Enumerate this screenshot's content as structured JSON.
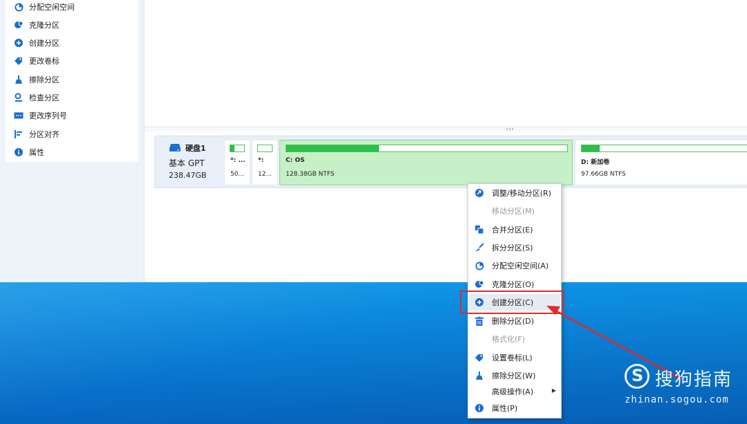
{
  "sidebar": {
    "items": [
      {
        "label": "分配空闲空间",
        "icon": "pie-chart-icon"
      },
      {
        "label": "克隆分区",
        "icon": "clone-icon"
      },
      {
        "label": "创建分区",
        "icon": "create-partition-icon"
      },
      {
        "label": "更改卷标",
        "icon": "tag-icon"
      },
      {
        "label": "擦除分区",
        "icon": "wipe-icon"
      },
      {
        "label": "检查分区",
        "icon": "check-icon"
      },
      {
        "label": "更改序列号",
        "icon": "serial-icon"
      },
      {
        "label": "分区对齐",
        "icon": "align-icon"
      },
      {
        "label": "属性",
        "icon": "info-icon"
      }
    ]
  },
  "disk": {
    "name": "硬盘1",
    "type": "基本 GPT",
    "size": "238.47GB",
    "partitions": [
      {
        "name": "*: ...",
        "size": "50...",
        "used_fraction": 0.3
      },
      {
        "name": "*:",
        "size": "12...",
        "used_fraction": 0.0
      },
      {
        "name": "C: OS",
        "size": "128.38GB NTFS",
        "used_fraction": 0.33
      },
      {
        "name": "D: 新加卷",
        "size": "97.66GB NTFS",
        "used_fraction": 0.1
      }
    ]
  },
  "context_menu": {
    "items": [
      {
        "label": "调整/移动分区(R)",
        "icon": "resize-icon",
        "enabled": true
      },
      {
        "label": "移动分区(M)",
        "icon": "",
        "enabled": false
      },
      {
        "label": "合并分区(E)",
        "icon": "merge-icon",
        "enabled": true
      },
      {
        "label": "拆分分区(S)",
        "icon": "split-icon",
        "enabled": true
      },
      {
        "label": "分配空闲空间(A)",
        "icon": "pie-chart-icon",
        "enabled": true
      },
      {
        "label": "克隆分区(O)",
        "icon": "clone-icon",
        "enabled": true
      },
      {
        "label": "创建分区(C)",
        "icon": "create-partition-icon",
        "enabled": true,
        "highlighted": true
      },
      {
        "label": "删除分区(D)",
        "icon": "trash-icon",
        "enabled": true
      },
      {
        "label": "格式化(F)",
        "icon": "",
        "enabled": false
      },
      {
        "label": "设置卷标(L)",
        "icon": "tag-icon",
        "enabled": true
      },
      {
        "label": "擦除分区(W)",
        "icon": "wipe-icon",
        "enabled": true
      },
      {
        "label": "高级操作(A)",
        "icon": "",
        "enabled": true,
        "submenu": true
      },
      {
        "label": "属性(P)",
        "icon": "info-icon",
        "enabled": true
      }
    ]
  },
  "watermark": {
    "logo_letter": "S",
    "text": "搜狗指南",
    "url": "zhinan.sogou.com"
  },
  "colors": {
    "accent": "#1a6fd0",
    "partition_used": "#2dbd4a",
    "selected_partition": "#c6f0c7",
    "annotation_red": "#e02a2a",
    "desktop": "#0a7fd6"
  }
}
